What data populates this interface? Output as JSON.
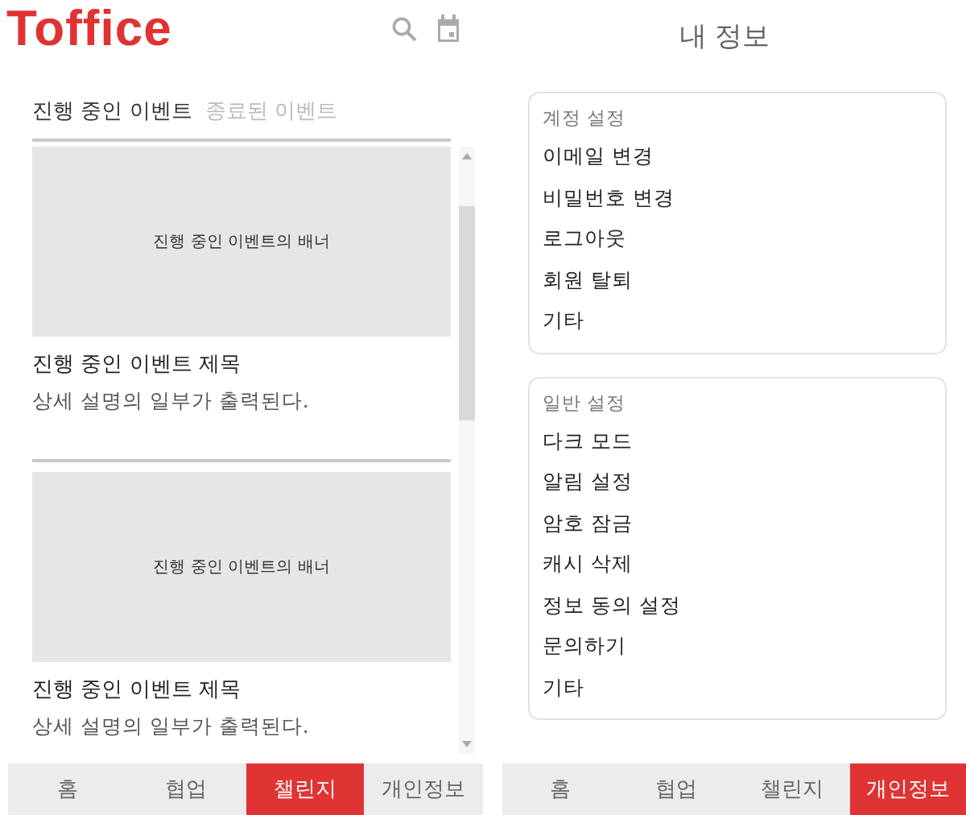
{
  "left_screen": {
    "logo": "Toffice",
    "tabs": [
      {
        "label": "진행 중인 이벤트",
        "selected": true
      },
      {
        "label": "종료된 이벤트",
        "selected": false
      }
    ],
    "events": [
      {
        "banner": "진행 중인 이벤트의 배너",
        "title": "진행 중인 이벤트 제목",
        "description": "상세 설명의 일부가 출력된다."
      },
      {
        "banner": "진행 중인 이벤트의 배너",
        "title": "진행 중인 이벤트 제목",
        "description": "상세 설명의 일부가 출력된다."
      }
    ],
    "nav_bar": [
      {
        "label": "홈",
        "selected": false
      },
      {
        "label": "협업",
        "selected": false
      },
      {
        "label": "챌린지",
        "selected": true
      },
      {
        "label": "개인정보",
        "selected": false
      }
    ]
  },
  "right_screen": {
    "title": "내 정보",
    "sections": [
      {
        "heading": "계정 설정",
        "items": [
          "이메일 변경",
          "비밀번호 변경",
          "로그아웃",
          "회원 탈퇴",
          "기타"
        ]
      },
      {
        "heading": "일반 설정",
        "items": [
          "다크 모드",
          "알림 설정",
          "암호 잠금",
          "캐시 삭제",
          "정보 동의 설정",
          "문의하기",
          "기타"
        ]
      }
    ],
    "nav_bar": [
      {
        "label": "홈",
        "selected": false
      },
      {
        "label": "협업",
        "selected": false
      },
      {
        "label": "챌린지",
        "selected": false
      },
      {
        "label": "개인정보",
        "selected": true
      }
    ]
  }
}
